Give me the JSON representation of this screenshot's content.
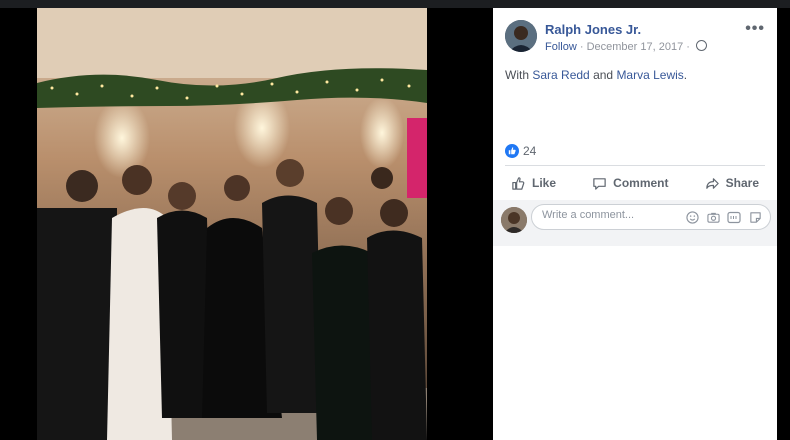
{
  "post": {
    "author": "Ralph Jones Jr.",
    "follow": "Follow",
    "dot": "·",
    "date": "December 17, 2017",
    "dot2": "·",
    "privacy_icon": "globe-icon",
    "more": "•••",
    "with_prefix": "With",
    "tagged": [
      "Sara Redd",
      "Marva Lewis"
    ],
    "and_word": "and",
    "period": ".",
    "like_count": "24"
  },
  "actions": {
    "like": "Like",
    "comment": "Comment",
    "share": "Share"
  },
  "comment_box": {
    "placeholder": "Write a comment...",
    "icons": [
      "emoji-icon",
      "camera-icon",
      "gif-icon",
      "sticker-icon"
    ]
  },
  "colors": {
    "link": "#385898",
    "like_blue": "#2078f4",
    "meta_gray": "#90949c"
  }
}
